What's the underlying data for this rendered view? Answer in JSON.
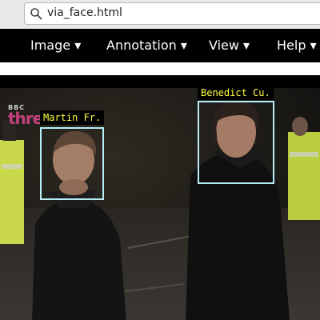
{
  "browser": {
    "address": "via_face.html",
    "search_icon": "search-icon"
  },
  "menu": {
    "items": [
      {
        "label": "Image ▾"
      },
      {
        "label": "Annotation ▾"
      },
      {
        "label": "View ▾"
      },
      {
        "label": "Help ▾"
      }
    ]
  },
  "image": {
    "watermark_top": "BBC",
    "watermark_bottom": "three",
    "watermark_color": "#c2407c"
  },
  "annotations": {
    "box_color": "#b8eef7",
    "label_color": "#ffff40",
    "regions": [
      {
        "label": "Martin Fr."
      },
      {
        "label": "Benedict Cu."
      }
    ]
  }
}
